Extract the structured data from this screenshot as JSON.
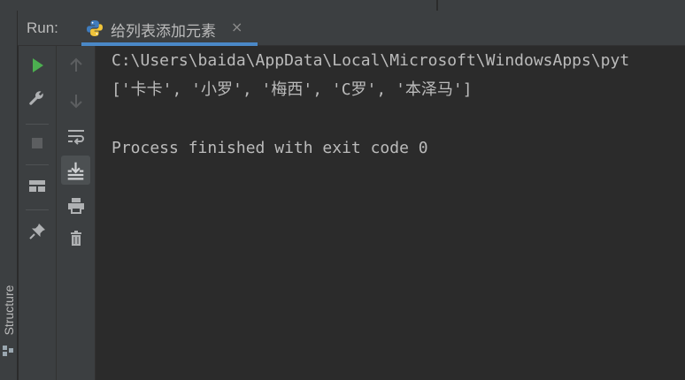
{
  "run_panel": {
    "label": "Run:",
    "tab": {
      "title": "给列表添加元素",
      "close_glyph": "×",
      "icon": "python-icon"
    }
  },
  "side_tab": {
    "label": "Structure",
    "icon": "structure-icon"
  },
  "toolbar_primary": [
    "rerun-icon",
    "wrench-icon",
    "stop-icon",
    "layout-icon",
    "pin-icon"
  ],
  "toolbar_secondary": [
    "up-arrow-icon",
    "down-arrow-icon",
    "soft-wrap-icon",
    "scroll-to-end-icon",
    "print-icon",
    "trash-icon"
  ],
  "console": {
    "lines": [
      "C:\\Users\\baida\\AppData\\Local\\Microsoft\\WindowsApps\\pyt",
      "['卡卡', '小罗', '梅西', 'C罗', '本泽马']",
      "",
      "Process finished with exit code 0"
    ]
  },
  "colors": {
    "panel_bg": "#3c3f41",
    "console_bg": "#2b2b2b",
    "text": "#bbbbbb",
    "accent": "#4a88c7",
    "run_green": "#4caf50"
  }
}
